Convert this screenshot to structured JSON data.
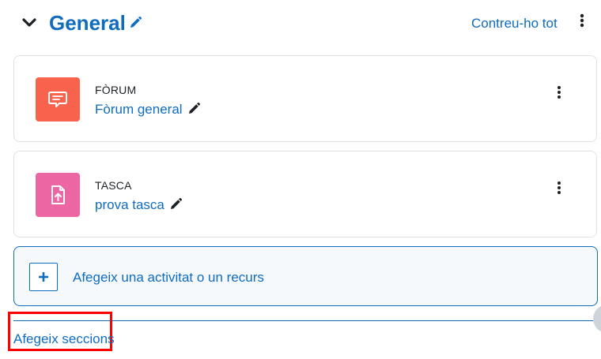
{
  "section": {
    "title": "General",
    "collapse_all_label": "Contreu-ho tot"
  },
  "activities": [
    {
      "type": "FÒRUM",
      "name": "Fòrum general",
      "icon": "forum-icon",
      "color": "#f7634d"
    },
    {
      "type": "TASCA",
      "name": "prova tasca",
      "icon": "assignment-icon",
      "color": "#eb66a2"
    }
  ],
  "add_activity": {
    "label": "Afegeix una activitat o un recurs"
  },
  "add_sections": {
    "label": "Afegeix seccions"
  },
  "colors": {
    "link": "#0f6cbf",
    "highlight": "#ff0000"
  }
}
